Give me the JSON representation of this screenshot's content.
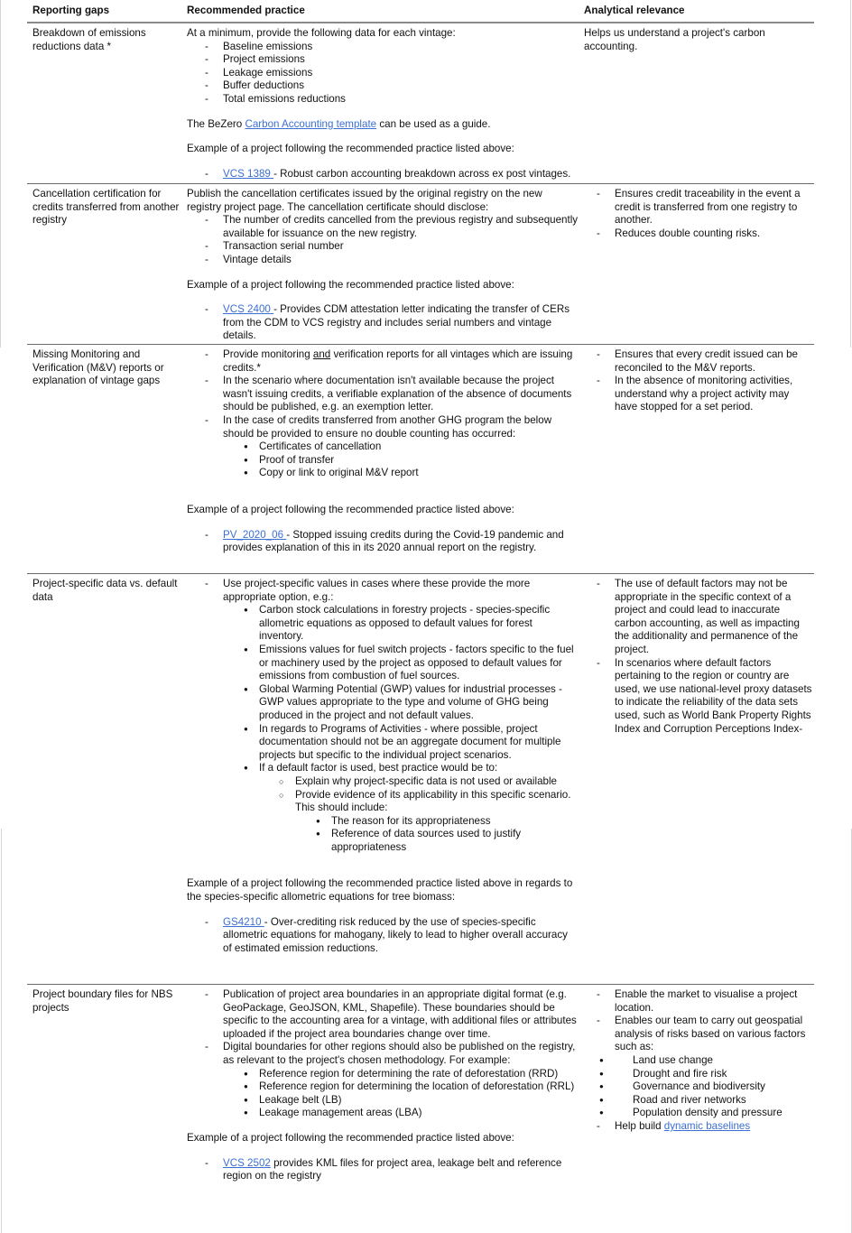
{
  "table": {
    "headers": [
      "Reporting gaps",
      "Recommended practice",
      "Analytical relevance"
    ],
    "rows": [
      {
        "gap": "Breakdown of emissions reductions data *",
        "practice": {
          "intro": "At a minimum, provide the following data for each vintage:",
          "items": [
            "Baseline emissions",
            "Project emissions",
            "Leakage emissions",
            "Buffer deductions",
            "Total emissions reductions"
          ],
          "guide_prefix": "The BeZero ",
          "guide_link": "Carbon Accounting template",
          "guide_suffix": " can be used as a guide.",
          "example_intro": "Example of a project following the recommended practice listed above:",
          "example_link": "VCS 1389 ",
          "example_text": "- Robust carbon accounting breakdown across ex post vintages."
        },
        "relevance": "Helps us understand a project's carbon accounting."
      },
      {
        "gap": "Cancellation certification for credits transferred from another registry",
        "practice": {
          "intro": "Publish the cancellation certificates issued by the original registry on the new registry project page. The cancellation certificate should disclose:",
          "items": [
            "The number of credits cancelled from the previous registry and subsequently available for issuance on the new registry.",
            "Transaction serial number",
            "Vintage details"
          ],
          "example_intro": "Example of a project following the recommended practice listed above:",
          "example_link": "VCS 2400 ",
          "example_text": "- Provides CDM attestation letter indicating the transfer of CERs from the CDM to VCS registry and includes serial numbers and vintage details."
        },
        "relevance": [
          "Ensures credit traceability in the event a credit is transferred from one registry to another.",
          "Reduces double counting risks."
        ]
      },
      {
        "gap": "Missing Monitoring and Verification (M&V) reports or explanation of vintage gaps",
        "practice": {
          "item1_prefix": "Provide monitoring ",
          "item1_underlined": "and",
          "item1_suffix": " verification reports for all vintages which are issuing credits.*",
          "item2": "In the scenario where documentation isn't available because the project wasn't issuing credits, a verifiable explanation of the absence of documents should be published, e.g. an exemption letter.",
          "item3": "In the case of credits transferred from another GHG program the below should be provided to ensure no double counting has occurred:",
          "item3_sub": [
            "Certificates of cancellation",
            "Proof of transfer",
            "Copy or link to original M&V report"
          ],
          "example_intro": "Example of a project following the recommended practice listed above:",
          "example_link": "PV_2020_06 ",
          "example_text": "- Stopped issuing credits during the Covid-19 pandemic and provides explanation of this in its 2020 annual report on the registry."
        },
        "relevance": [
          "Ensures that every credit issued can be reconciled to the M&V reports.",
          "In the absence of monitoring activities, understand why a project activity may have stopped for a set period."
        ]
      },
      {
        "gap": "Project-specific data vs. default data",
        "practice": {
          "item1": "Use project-specific values in cases where these provide the more appropriate option, e.g.:",
          "sub": [
            "Carbon stock calculations in forestry projects - species-specific allometric equations as opposed to default values for forest inventory.",
            "Emissions values for fuel switch projects - factors specific to the fuel or machinery used by the project as opposed to default values for emissions from combustion of fuel sources.",
            "Global Warming Potential  (GWP) values for industrial processes - GWP values appropriate to the type and volume of GHG being produced in the project and not default values.",
            "In regards to Programs of Activities - where possible, project documentation should not be an aggregate document for multiple projects but specific to the individual project scenarios.",
            "If a default factor is used, best practice would be to:"
          ],
          "sub_sub": [
            "Explain why project-specific data is not used or available",
            "Provide evidence of its applicability in this specific scenario. This should include:"
          ],
          "sub_sub_sub": [
            "The reason for its appropriateness",
            "Reference of data sources used to justify appropriateness"
          ],
          "example_intro": "Example of a project following the recommended practice listed above in regards to the species-specific allometric equations for tree biomass:",
          "example_link": "GS4210 ",
          "example_text": "- Over-crediting risk reduced by the use of species-specific allometric equations for mahogany, likely to lead to higher overall accuracy of estimated emission reductions."
        },
        "relevance": [
          "The use of default factors may not be appropriate in the specific context of a project and could lead to inaccurate carbon accounting, as well as impacting the additionality and permanence of the project.",
          "In scenarios where default factors pertaining to the region or country are used, we use national-level proxy datasets to indicate the reliability of the data sets used, such as World Bank Property Rights Index and Corruption Perceptions Index-"
        ]
      },
      {
        "gap": "Project boundary files for NBS projects",
        "practice": {
          "item1": "Publication of project area boundaries in an appropriate digital format (e.g. GeoPackage, GeoJSON, KML, Shapefile). These boundaries should be specific to the accounting area for a vintage, with additional files or attributes uploaded if the project area boundaries change over time.",
          "item2": "Digital boundaries for other regions should also be published on the registry, as relevant to the project's chosen methodology. For example:",
          "item2_sub": [
            "Reference region for determining the rate of deforestation (RRD)",
            "Reference region for determining the location of deforestation (RRL)",
            "Leakage belt (LB)",
            "Leakage management areas (LBA)"
          ],
          "example_intro": "Example of a project following the recommended practice listed above:",
          "example_link": "VCS 2502",
          "example_text": " provides KML files for project area, leakage belt and reference region on the registry"
        },
        "relevance": {
          "item1": "Enable the market to visualise a project location.",
          "item2": "Enables our team to carry out geospatial analysis of risks based on various factors such as:",
          "item2_sub": [
            "Land use change",
            "Drought and fire risk",
            "Governance and biodiversity",
            "Road and river networks",
            "Population density and pressure"
          ],
          "item3_prefix": "Help build ",
          "item3_link": "dynamic baselines"
        }
      }
    ]
  },
  "colors": {
    "link": "#3b6fd4",
    "rule": "#6a6a6a"
  }
}
